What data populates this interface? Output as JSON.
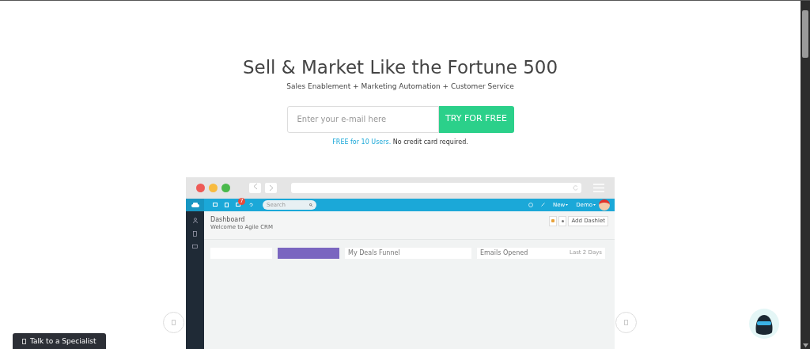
{
  "hero": {
    "title": "Sell & Market Like the Fortune 500",
    "subtitle": "Sales Enablement + Marketing Automation + Customer Service",
    "email_placeholder": "Enter your e-mail here",
    "cta": "TRY FOR FREE",
    "note_link": "FREE for 10 Users.",
    "note": "No credit card required."
  },
  "preview": {
    "search_placeholder": "Search",
    "badge": "7",
    "menus": [
      "New",
      "Demo"
    ],
    "page_title": "Dashboard",
    "page_subtitle": "Welcome to Agile CRM",
    "add_button": "Add Dashlet",
    "cards": [
      {
        "kind": "empty"
      },
      {
        "kind": "highlight"
      },
      {
        "kind": "titled",
        "title": "My Deals Funnel"
      },
      {
        "kind": "titled",
        "title": "Emails Opened",
        "meta": "Last 2 Days"
      }
    ]
  },
  "chat_button": "Talk to a Specialist"
}
